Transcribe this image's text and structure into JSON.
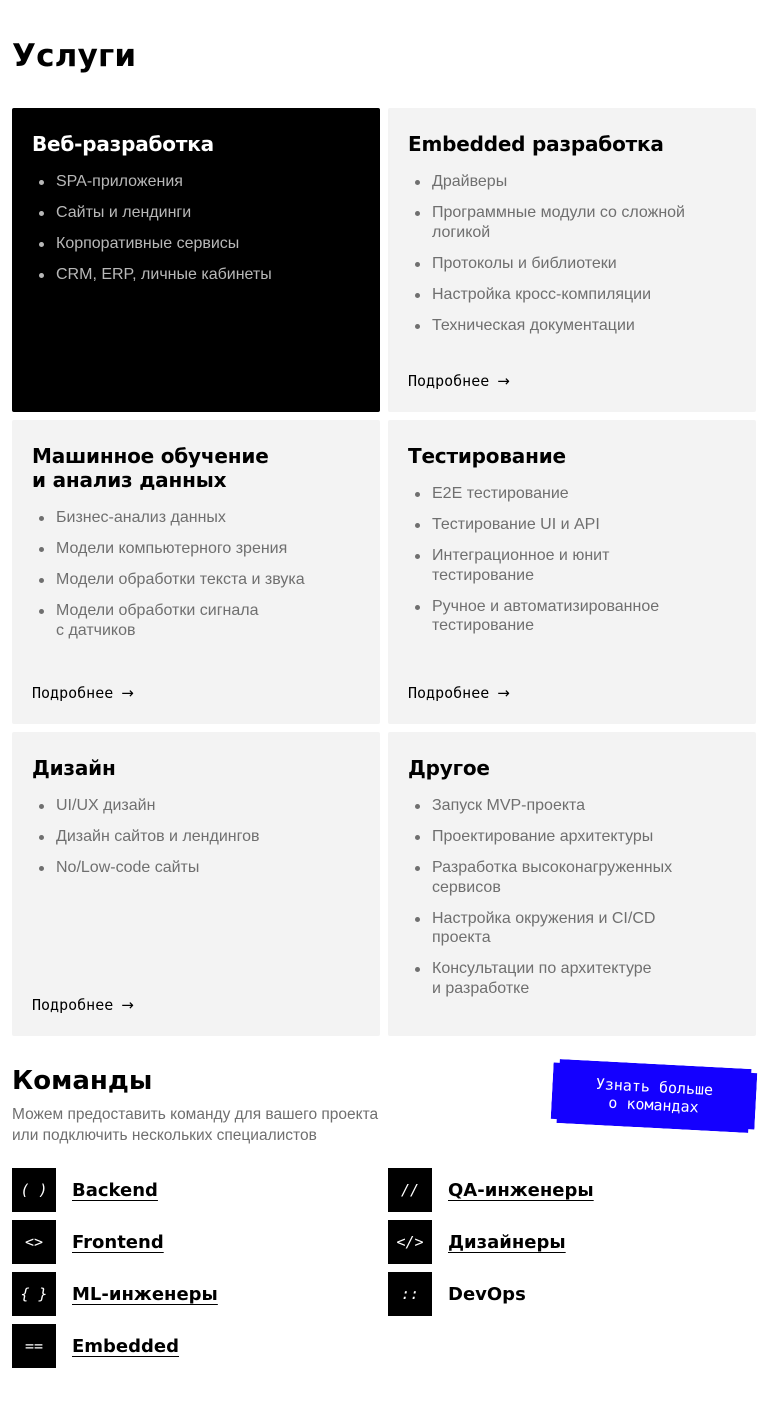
{
  "services": {
    "title": "Услуги",
    "more_label": "Подробнее",
    "arrow": "→",
    "cards": [
      {
        "title": "Веб-разработка",
        "items": [
          "SPA-приложения",
          "Сайты и лендинги",
          "Корпоративные сервисы",
          "CRM, ERP, личные кабинеты"
        ]
      },
      {
        "title": "Embedded разработка",
        "items": [
          "Драйверы",
          "Программные модули со сложной\nлогикой",
          "Протоколы и библиотеки",
          "Настройка кросс-компиляции",
          "Техническая документации"
        ]
      },
      {
        "title": "Машинное обучение\nи анализ данных",
        "items": [
          "Бизнес-анализ данных",
          "Модели компьютерного зрения",
          "Модели обработки текста и звука",
          "Модели обработки сигнала\nс датчиков"
        ]
      },
      {
        "title": "Тестирование",
        "items": [
          "E2E тестирование",
          "Тестирование UI и API",
          "Интеграционное и юнит\nтестирование",
          "Ручное и автоматизированное\nтестирование"
        ]
      },
      {
        "title": "Дизайн",
        "items": [
          "UI/UX дизайн",
          "Дизайн сайтов и лендингов",
          "No/Low-code сайты"
        ]
      },
      {
        "title": "Другое",
        "items": [
          "Запуск MVP-проекта",
          "Проектирование архитектуры",
          "Разработка высоконагруженных\nсервисов",
          "Настройка окружения и CI/CD\nпроекта",
          "Консультации по архитектуре\nи разработке"
        ]
      }
    ]
  },
  "teams": {
    "title": "Команды",
    "subtitle": "Можем предоставить команду для вашего проекта\nили подключить нескольких специалистов",
    "button_label": "Узнать больше\nо командах",
    "roles": [
      {
        "icon": "( )",
        "icon_name": "parentheses-icon",
        "label": "Backend"
      },
      {
        "icon": "//",
        "icon_name": "double-slash-icon",
        "label": "QA-инженеры"
      },
      {
        "icon": "<>",
        "icon_name": "angle-brackets-icon",
        "label": "Frontend"
      },
      {
        "icon": "</>",
        "icon_name": "code-tag-icon",
        "label": "Дизайнеры"
      },
      {
        "icon": "{ }",
        "icon_name": "curly-braces-icon",
        "label": "ML-инженеры"
      },
      {
        "icon": "::",
        "icon_name": "double-colon-icon",
        "label": "DevOps"
      },
      {
        "icon": "==",
        "icon_name": "double-equals-icon",
        "label": "Embedded"
      }
    ]
  },
  "colors": {
    "accent": "#1400ff",
    "card_bg": "#f3f3f3",
    "dark_card_bg": "#000000",
    "muted_text": "#6f6f6f"
  }
}
